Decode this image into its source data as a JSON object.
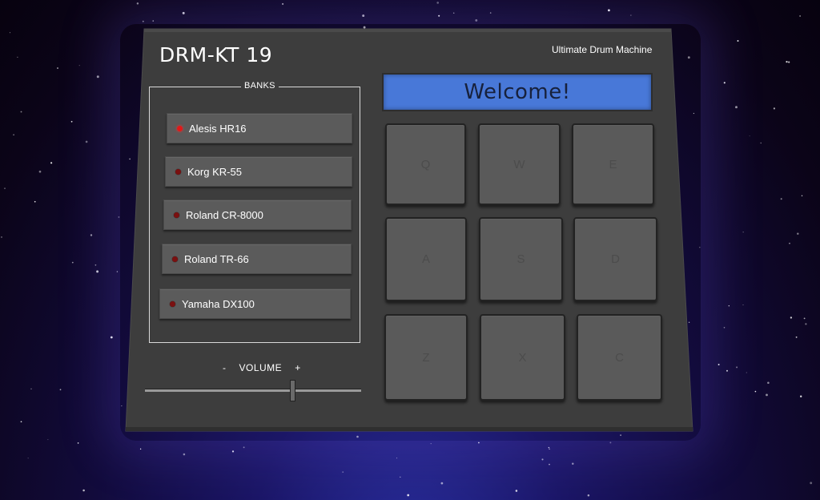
{
  "header": {
    "title": "DRM-KT 19",
    "subtitle": "Ultimate Drum Machine"
  },
  "banks": {
    "label": "BANKS",
    "active_index": 0,
    "items": [
      {
        "label": "Alesis HR16"
      },
      {
        "label": "Korg KR-55"
      },
      {
        "label": "Roland CR-8000"
      },
      {
        "label": "Roland TR-66"
      },
      {
        "label": "Yamaha DX100"
      }
    ]
  },
  "volume": {
    "minus": "-",
    "label": "VOLUME",
    "plus": "+",
    "level": 0.69
  },
  "display": {
    "text": "Welcome!"
  },
  "pads": [
    "Q",
    "W",
    "E",
    "A",
    "S",
    "D",
    "Z",
    "X",
    "C"
  ],
  "colors": {
    "display_bg": "#4878d8",
    "led_active": "#e01919",
    "led_inactive": "#7a1010",
    "machine_body": "#3d3d3d"
  }
}
